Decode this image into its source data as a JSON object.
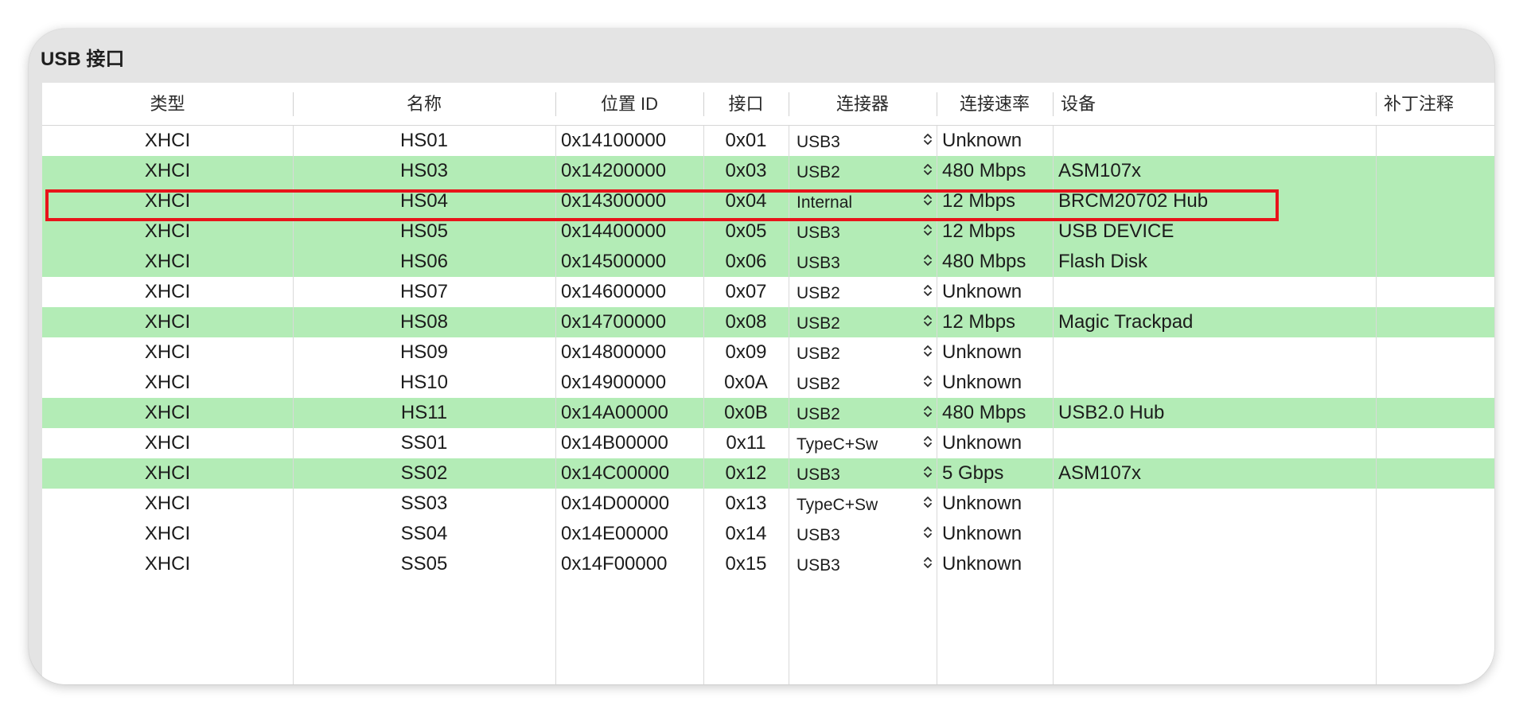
{
  "panel": {
    "title": "USB 接口"
  },
  "columns": [
    {
      "key": "type",
      "label": "类型"
    },
    {
      "key": "name",
      "label": "名称"
    },
    {
      "key": "location_id",
      "label": "位置 ID"
    },
    {
      "key": "port",
      "label": "接口"
    },
    {
      "key": "connector",
      "label": "连接器"
    },
    {
      "key": "speed",
      "label": "连接速率"
    },
    {
      "key": "device",
      "label": "设备"
    },
    {
      "key": "comment",
      "label": "补丁注释"
    }
  ],
  "rows": [
    {
      "type": "XHCI",
      "name": "HS01",
      "location_id": "0x14100000",
      "port": "0x01",
      "connector": "USB3",
      "speed": "Unknown",
      "device": "",
      "comment": "",
      "active": false
    },
    {
      "type": "XHCI",
      "name": "HS03",
      "location_id": "0x14200000",
      "port": "0x03",
      "connector": "USB2",
      "speed": "480 Mbps",
      "device": "ASM107x",
      "comment": "",
      "active": true
    },
    {
      "type": "XHCI",
      "name": "HS04",
      "location_id": "0x14300000",
      "port": "0x04",
      "connector": "Internal",
      "speed": "12 Mbps",
      "device": "BRCM20702 Hub",
      "comment": "",
      "active": true
    },
    {
      "type": "XHCI",
      "name": "HS05",
      "location_id": "0x14400000",
      "port": "0x05",
      "connector": "USB3",
      "speed": "12 Mbps",
      "device": "USB DEVICE",
      "comment": "",
      "active": true
    },
    {
      "type": "XHCI",
      "name": "HS06",
      "location_id": "0x14500000",
      "port": "0x06",
      "connector": "USB3",
      "speed": "480 Mbps",
      "device": "Flash Disk",
      "comment": "",
      "active": true
    },
    {
      "type": "XHCI",
      "name": "HS07",
      "location_id": "0x14600000",
      "port": "0x07",
      "connector": "USB2",
      "speed": "Unknown",
      "device": "",
      "comment": "",
      "active": false
    },
    {
      "type": "XHCI",
      "name": "HS08",
      "location_id": "0x14700000",
      "port": "0x08",
      "connector": "USB2",
      "speed": "12 Mbps",
      "device": "Magic Trackpad",
      "comment": "",
      "active": true
    },
    {
      "type": "XHCI",
      "name": "HS09",
      "location_id": "0x14800000",
      "port": "0x09",
      "connector": "USB2",
      "speed": "Unknown",
      "device": "",
      "comment": "",
      "active": false
    },
    {
      "type": "XHCI",
      "name": "HS10",
      "location_id": "0x14900000",
      "port": "0x0A",
      "connector": "USB2",
      "speed": "Unknown",
      "device": "",
      "comment": "",
      "active": false
    },
    {
      "type": "XHCI",
      "name": "HS11",
      "location_id": "0x14A00000",
      "port": "0x0B",
      "connector": "USB2",
      "speed": "480 Mbps",
      "device": "USB2.0 Hub",
      "comment": "",
      "active": true
    },
    {
      "type": "XHCI",
      "name": "SS01",
      "location_id": "0x14B00000",
      "port": "0x11",
      "connector": "TypeC+Sw",
      "speed": "Unknown",
      "device": "",
      "comment": "",
      "active": false
    },
    {
      "type": "XHCI",
      "name": "SS02",
      "location_id": "0x14C00000",
      "port": "0x12",
      "connector": "USB3",
      "speed": "5 Gbps",
      "device": "ASM107x",
      "comment": "",
      "active": true
    },
    {
      "type": "XHCI",
      "name": "SS03",
      "location_id": "0x14D00000",
      "port": "0x13",
      "connector": "TypeC+Sw",
      "speed": "Unknown",
      "device": "",
      "comment": "",
      "active": false
    },
    {
      "type": "XHCI",
      "name": "SS04",
      "location_id": "0x14E00000",
      "port": "0x14",
      "connector": "USB3",
      "speed": "Unknown",
      "device": "",
      "comment": "",
      "active": false
    },
    {
      "type": "XHCI",
      "name": "SS05",
      "location_id": "0x14F00000",
      "port": "0x15",
      "connector": "USB3",
      "speed": "Unknown",
      "device": "",
      "comment": "",
      "active": false
    }
  ],
  "stepper_icon": "up-down-chevron-icon",
  "colors": {
    "active_row": "#b3ecb6",
    "highlight_border": "#e8141b",
    "panel_background": "#e4e4e4"
  },
  "annotation": {
    "highlighted_row_name": "HS04"
  }
}
